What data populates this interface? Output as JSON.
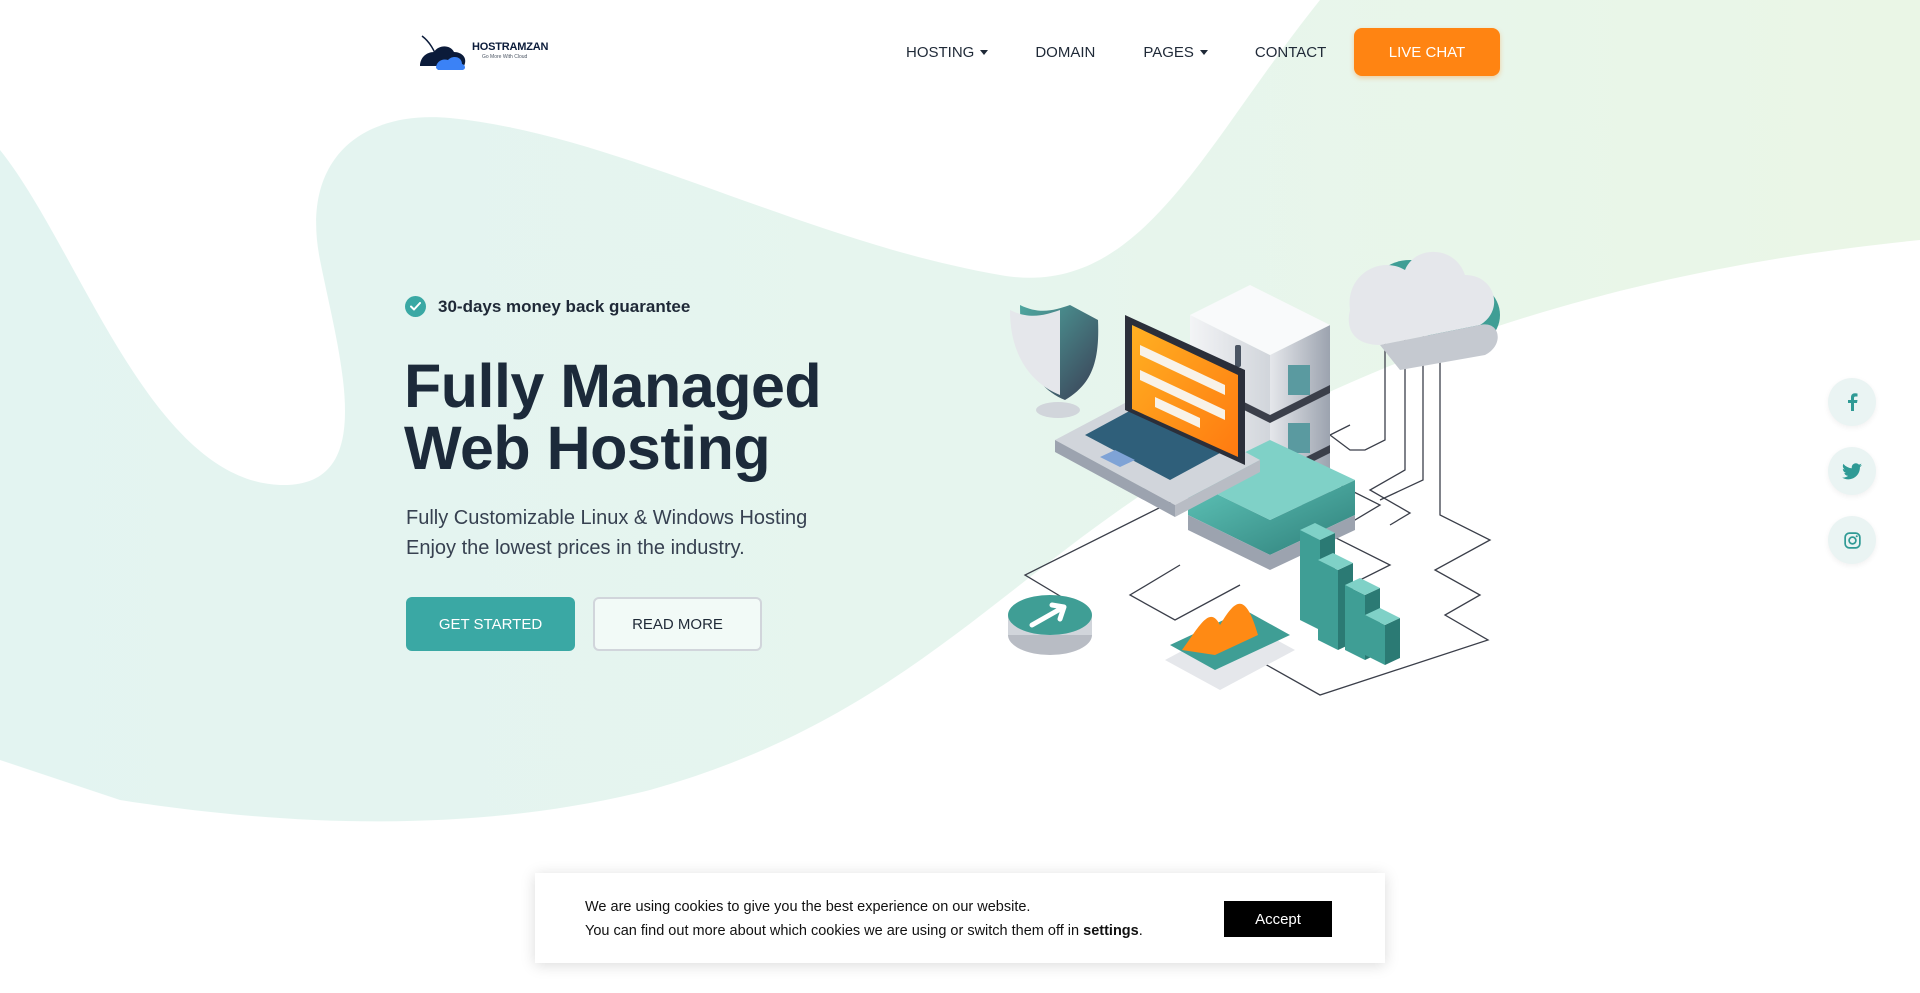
{
  "brand": {
    "name": "HOSTRAMZAN",
    "tagline": "Go More With Cloud"
  },
  "nav": {
    "items": [
      {
        "label": "HOSTING",
        "dropdown": true
      },
      {
        "label": "DOMAIN",
        "dropdown": false
      },
      {
        "label": "PAGES",
        "dropdown": true
      },
      {
        "label": "CONTACT",
        "dropdown": false
      }
    ],
    "cta_label": "LIVE CHAT"
  },
  "hero": {
    "badge": "30-days money back guarantee",
    "title_line1": "Fully Managed",
    "title_line2": "Web Hosting",
    "subtitle_line1": "Fully Customizable Linux & Windows Hosting",
    "subtitle_line2": "Enjoy the lowest prices in the industry.",
    "primary_button": "GET STARTED",
    "secondary_button": "READ MORE"
  },
  "social": [
    {
      "icon": "facebook-icon"
    },
    {
      "icon": "twitter-icon"
    },
    {
      "icon": "instagram-icon"
    }
  ],
  "cookie": {
    "line1": "We are using cookies to give you the best experience on our website.",
    "line2_prefix": "You can find out more about which cookies we are using or switch them off in ",
    "settings_link": "settings",
    "line2_suffix": ".",
    "accept_label": "Accept"
  },
  "colors": {
    "accent_teal": "#3aa8a4",
    "accent_orange": "#ff8412",
    "text_dark": "#1c2a3a"
  }
}
